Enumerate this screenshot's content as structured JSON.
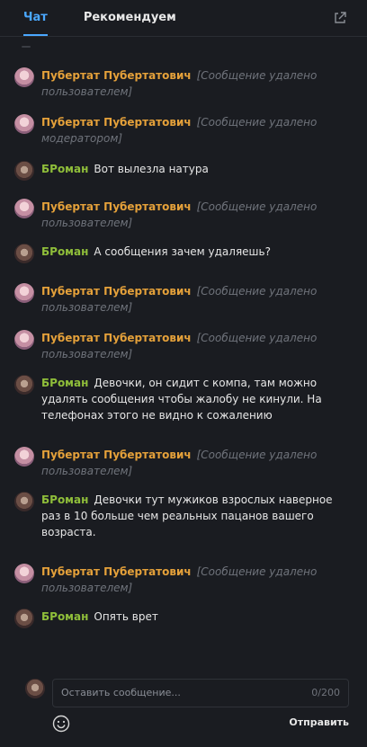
{
  "tabs": {
    "chat": "Чат",
    "recommend": "Рекомендуем"
  },
  "messages": [
    {
      "user": "Пубертат Пубертатович",
      "text": "[Сообщение удалено пользователем]",
      "deleted": true,
      "color": "orange",
      "avatar": "pink"
    },
    {
      "user": "Пубертат Пубертатович",
      "text": "[Сообщение удалено модератором]",
      "deleted": true,
      "color": "orange",
      "avatar": "pink"
    },
    {
      "user": "БРоман",
      "text": "Вот вылезла натура",
      "deleted": false,
      "color": "green",
      "avatar": "dark"
    },
    {
      "user": "Пубертат Пубертатович",
      "text": "[Сообщение удалено пользователем]",
      "deleted": true,
      "color": "orange",
      "avatar": "pink"
    },
    {
      "user": "БРоман",
      "text": "А сообщения зачем удаляешь?",
      "deleted": false,
      "color": "green",
      "avatar": "dark"
    },
    {
      "user": "Пубертат Пубертатович",
      "text": "[Сообщение удалено пользователем]",
      "deleted": true,
      "color": "orange",
      "avatar": "pink"
    },
    {
      "user": "Пубертат Пубертатович",
      "text": "[Сообщение удалено пользователем]",
      "deleted": true,
      "color": "orange",
      "avatar": "pink"
    },
    {
      "user": "БРоман",
      "text": "Девочки, он сидит с компа, там можно удалять сообщения чтобы жалобу не кинули. На телефонах этого не видно к сожалению",
      "deleted": false,
      "color": "green",
      "avatar": "dark"
    },
    {
      "user": "Пубертат Пубертатович",
      "text": "[Сообщение удалено пользователем]",
      "deleted": true,
      "color": "orange",
      "avatar": "pink"
    },
    {
      "user": "БРоман",
      "text": "Девочки тут мужиков взрослых наверное раз в 10 больше чем реальных пацанов вашего возраста.",
      "deleted": false,
      "color": "green",
      "avatar": "dark"
    },
    {
      "user": "Пубертат Пубертатович",
      "text": "[Сообщение удалено пользователем]",
      "deleted": true,
      "color": "orange",
      "avatar": "pink"
    },
    {
      "user": "БРоман",
      "text": "Опять врет",
      "deleted": false,
      "color": "green",
      "avatar": "dark"
    }
  ],
  "composer": {
    "placeholder": "Оставить сообщение...",
    "counter": "0/200",
    "send_label": "Отправить"
  },
  "colors": {
    "accent": "#4aa8ff",
    "orange_name": "#e5a13a",
    "green_name": "#8fbe3a",
    "background": "#1a1c21"
  },
  "icons": {
    "popout": "external-link-icon",
    "emoji": "smiley-icon"
  }
}
